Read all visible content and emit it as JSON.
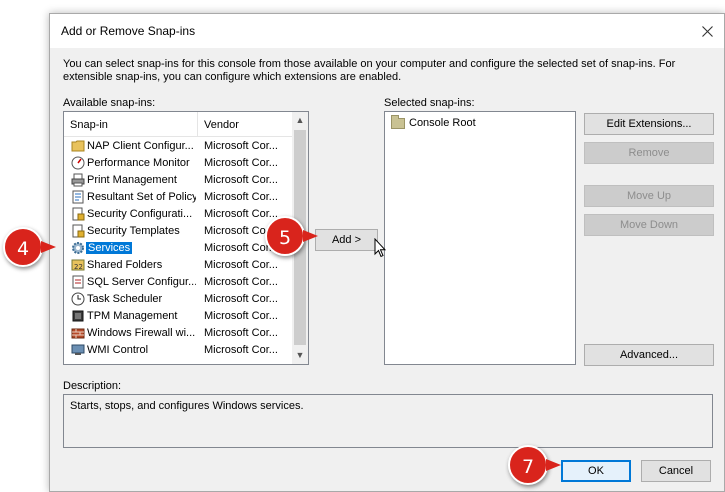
{
  "dialog": {
    "title": "Add or Remove Snap-ins",
    "intro": "You can select snap-ins for this console from those available on your computer and configure the selected set of snap-ins. For extensible snap-ins, you can configure which extensions are enabled."
  },
  "available": {
    "label": "Available snap-ins:",
    "col_snapin": "Snap-in",
    "col_vendor": "Vendor",
    "items": [
      {
        "name": "NAP Client Configur...",
        "vendor": "Microsoft Cor...",
        "icon": "folder-icon"
      },
      {
        "name": "Performance Monitor",
        "vendor": "Microsoft Cor...",
        "icon": "performance-icon"
      },
      {
        "name": "Print Management",
        "vendor": "Microsoft Cor...",
        "icon": "printer-icon"
      },
      {
        "name": "Resultant Set of Policy",
        "vendor": "Microsoft Cor...",
        "icon": "policy-icon"
      },
      {
        "name": "Security Configurati...",
        "vendor": "Microsoft Cor...",
        "icon": "security-config-icon"
      },
      {
        "name": "Security Templates",
        "vendor": "Microsoft Co",
        "icon": "security-template-icon"
      },
      {
        "name": "Services",
        "vendor": "Microsoft Cor...",
        "icon": "gear-icon"
      },
      {
        "name": "Shared Folders",
        "vendor": "Microsoft Cor...",
        "icon": "shared-folder-icon"
      },
      {
        "name": "SQL Server Configur...",
        "vendor": "Microsoft Cor...",
        "icon": "sql-icon"
      },
      {
        "name": "Task Scheduler",
        "vendor": "Microsoft Cor...",
        "icon": "clock-icon"
      },
      {
        "name": "TPM Management",
        "vendor": "Microsoft Cor...",
        "icon": "tpm-icon"
      },
      {
        "name": "Windows Firewall wi...",
        "vendor": "Microsoft Cor...",
        "icon": "firewall-icon"
      },
      {
        "name": "WMI Control",
        "vendor": "Microsoft Cor...",
        "icon": "wmi-icon"
      }
    ]
  },
  "add_button": "Add >",
  "selected": {
    "label": "Selected snap-ins:",
    "items": [
      {
        "name": "Console Root",
        "icon": "folder-icon"
      }
    ]
  },
  "buttons": {
    "edit_extensions": "Edit Extensions...",
    "remove": "Remove",
    "move_up": "Move Up",
    "move_down": "Move Down",
    "advanced": "Advanced...",
    "ok": "OK",
    "cancel": "Cancel"
  },
  "description": {
    "label": "Description:",
    "text": "Starts, stops, and configures Windows services."
  },
  "badges": [
    "4",
    "5",
    "7"
  ],
  "colors": {
    "selection": "#0078d7",
    "badge": "#d9241c",
    "dialog_bg": "#f0f0f0"
  }
}
